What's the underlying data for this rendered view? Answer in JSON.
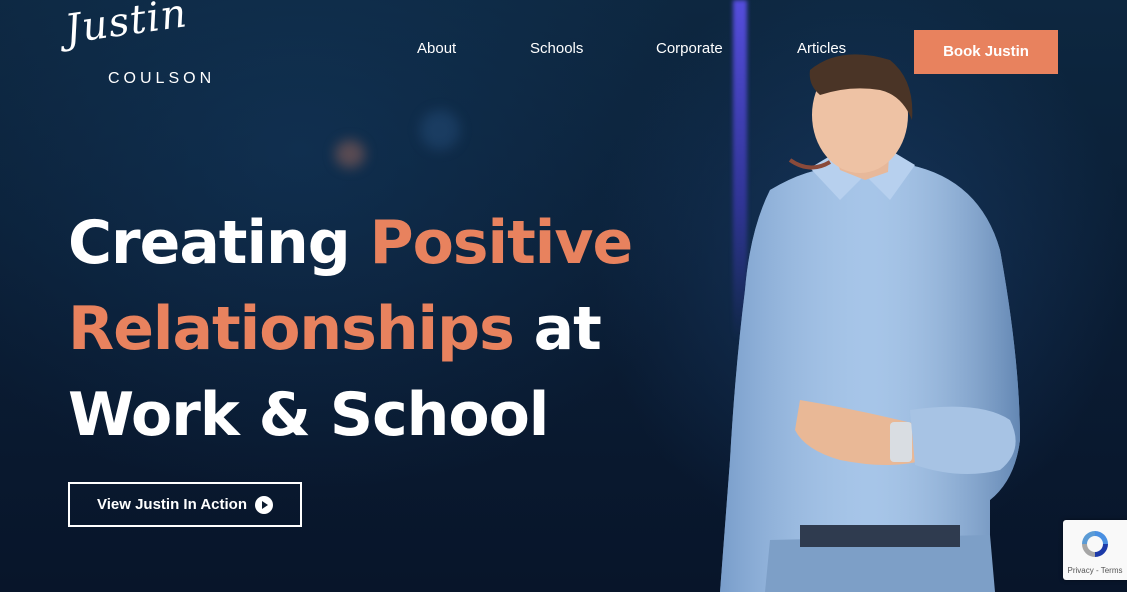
{
  "logo": {
    "script": "Justin",
    "sub": "COULSON"
  },
  "nav": {
    "items": [
      {
        "label": "About"
      },
      {
        "label": "Schools"
      },
      {
        "label": "Corporate"
      },
      {
        "label": "Articles"
      }
    ],
    "book_label": "Book Justin"
  },
  "hero": {
    "line1_white": "Creating ",
    "line1_accent": "Positive",
    "line2_accent": "Relationships",
    "line2_white": " at",
    "line3_white": "Work & School",
    "cta_label": "View Justin In Action"
  },
  "recaptcha": {
    "text": "Privacy - Terms"
  },
  "colors": {
    "accent": "#e8825e",
    "background": "#0b1a2e",
    "text": "#ffffff"
  },
  "icons": {
    "cta": "play-circle-icon",
    "recaptcha": "recaptcha-icon"
  }
}
